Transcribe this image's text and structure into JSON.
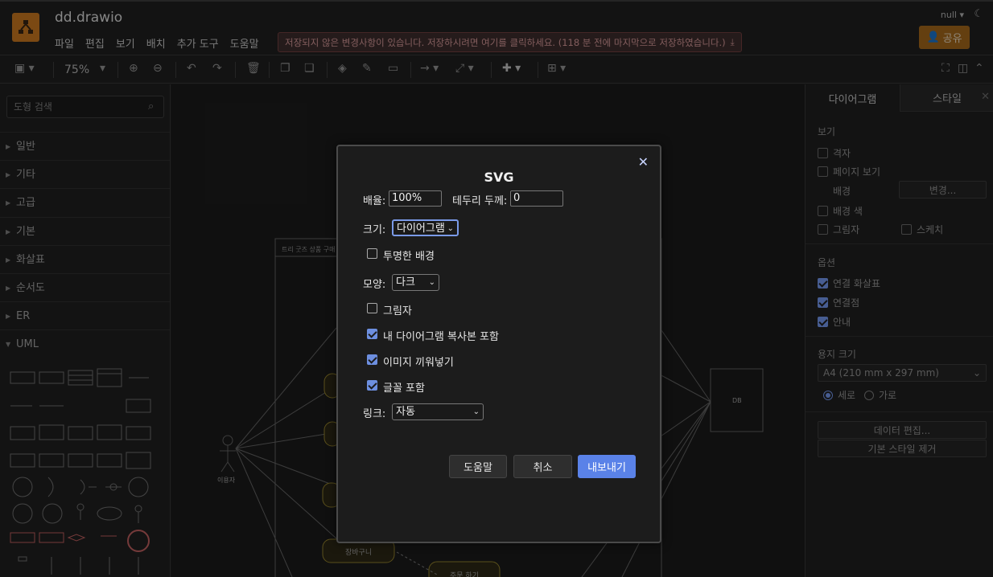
{
  "app": {
    "filename": "dd.drawio",
    "menu": [
      "파일",
      "편집",
      "보기",
      "배치",
      "추가 도구",
      "도움말"
    ],
    "unsaved_notice": "저장되지 않은 변경사항이 있습니다. 저장하시려면 여기를 클릭하세요. (118 분 전에 마지막으로 저장하였습니다.)",
    "user": "null",
    "share_label": "공유"
  },
  "toolbar": {
    "zoom": "75%"
  },
  "left_panel": {
    "search_placeholder": "도형 검색",
    "categories": [
      "일반",
      "기타",
      "고급",
      "기본",
      "화살표",
      "순서도",
      "ER",
      "UML"
    ]
  },
  "canvas": {
    "frame_title": "트리 굿즈 상품 구매",
    "actor_label": "이용자",
    "db_label": "DB",
    "cart_label": "장바구니",
    "order_label": "주문 하기"
  },
  "right_panel": {
    "tabs": [
      "다이어그램",
      "스타일"
    ],
    "view_section": "보기",
    "grid": "격자",
    "page_view": "페이지 보기",
    "background": "배경",
    "change_btn": "변경...",
    "bg_color": "배경 색",
    "shadow": "그림자",
    "sketch": "스케치",
    "options_section": "옵션",
    "connection_arrows": "연결 화살표",
    "connection_points": "연결점",
    "guides": "안내",
    "paper_section": "용지 크기",
    "paper_size": "A4 (210 mm x 297 mm)",
    "portrait": "세로",
    "landscape": "가로",
    "edit_data": "데이터 편집...",
    "clear_style": "기본 스타일 제거"
  },
  "dialog": {
    "title": "SVG",
    "scale_label": "배율:",
    "scale_value": "100%",
    "border_label": "테두리 두께:",
    "border_value": "0",
    "size_label": "크기:",
    "size_value": "다이어그램",
    "transparent_bg": "투명한 배경",
    "theme_label": "모양:",
    "theme_value": "다크",
    "shadow": "그림자",
    "include_copy": "내 다이어그램 복사본 포함",
    "embed_images": "이미지 끼워넣기",
    "include_fonts": "글꼴 포함",
    "links_label": "링크:",
    "links_value": "자동",
    "help_btn": "도움말",
    "cancel_btn": "취소",
    "export_btn": "내보내기"
  }
}
